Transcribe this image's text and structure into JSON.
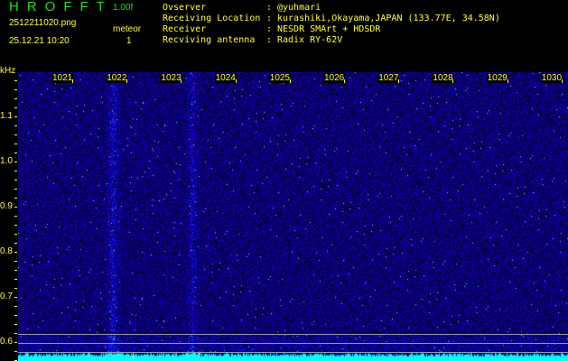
{
  "header": {
    "logo": "HROFFT",
    "version": "1.00f",
    "filename": "2512211020.png",
    "datetime": "25.12.21 10:20",
    "event_label": "meteor",
    "event_count": "1",
    "info": [
      {
        "label": "Ovserver",
        "value": "@yuhmari"
      },
      {
        "label": "Receiving Location",
        "value": "kurashiki,Okayama,JAPAN (133.77E, 34.58N)"
      },
      {
        "label": "Receiver",
        "value": "NESDR SMArt + HDSDR"
      },
      {
        "label": "Recviving antenna",
        "value": "Radix RY-62V"
      }
    ]
  },
  "axes": {
    "y_unit": "kHz",
    "x_ticks": [
      "1021",
      "1022",
      "1023",
      "1024",
      "1025",
      "1026",
      "1027",
      "1028",
      "1029",
      "1030"
    ],
    "y_ticks": [
      "1.1",
      "1.0",
      "0.9",
      "0.8",
      "0.7",
      "0.6"
    ]
  },
  "colors": {
    "text": "#ffff33",
    "logo": "#22dd22",
    "spectrum": "#00ffff"
  }
}
